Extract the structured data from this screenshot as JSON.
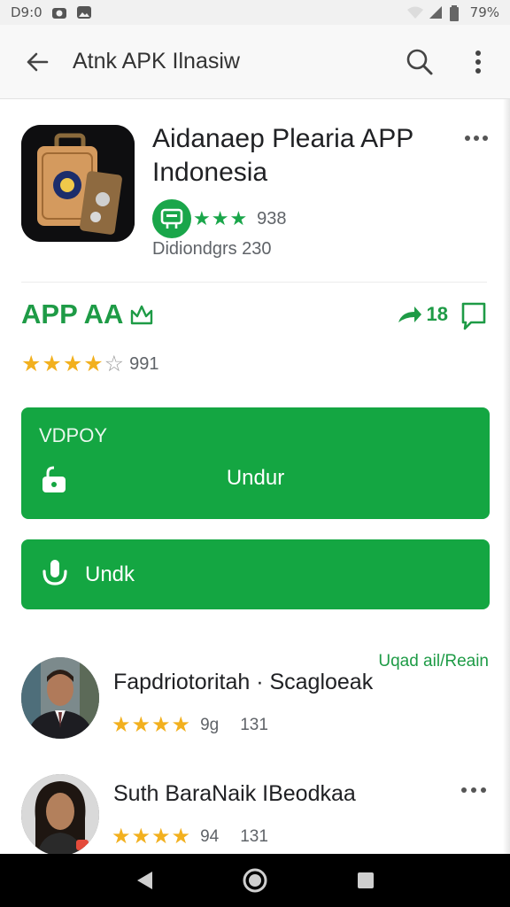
{
  "status_bar": {
    "time": "D9:0",
    "battery": "79%",
    "icons": [
      "camera-icon",
      "photo-icon",
      "wifi-icon",
      "signal-icon",
      "battery-icon"
    ]
  },
  "app_bar": {
    "title": "Atnk APK Ilnasiw",
    "icons": [
      "back-arrow-icon",
      "search-icon",
      "overflow-menu-icon"
    ]
  },
  "app": {
    "title": "Aidanaep Plearia APP Indonesia",
    "rating_stars": "★★★",
    "rating_count": "938",
    "developer": "Didiondgrs 230",
    "icon": "luggage-app-icon"
  },
  "section": {
    "title": "APP AA",
    "share_count": "18",
    "rating_stars": "★★★★",
    "rating_empty": "☆",
    "rating_score": "991"
  },
  "buttons": {
    "primary_caption": "VDPOY",
    "primary_label": "Undur",
    "secondary_label": "Undk"
  },
  "reviews": {
    "link": "Uqad ail/Reain",
    "items": [
      {
        "name": "Fapdriotoritah · Scagloeak",
        "stars": "★★★★",
        "score": "9g",
        "count": "131"
      },
      {
        "name": "Suth BaraNaik  IBeodkaa",
        "stars": "★★★★",
        "score": "94",
        "count": "131"
      }
    ]
  },
  "nav": {
    "icons": [
      "nav-back-icon",
      "nav-home-icon",
      "nav-recents-icon"
    ]
  },
  "colors": {
    "accent": "#14a642",
    "accent_text": "#1e9b46",
    "star": "#f2b01e"
  }
}
